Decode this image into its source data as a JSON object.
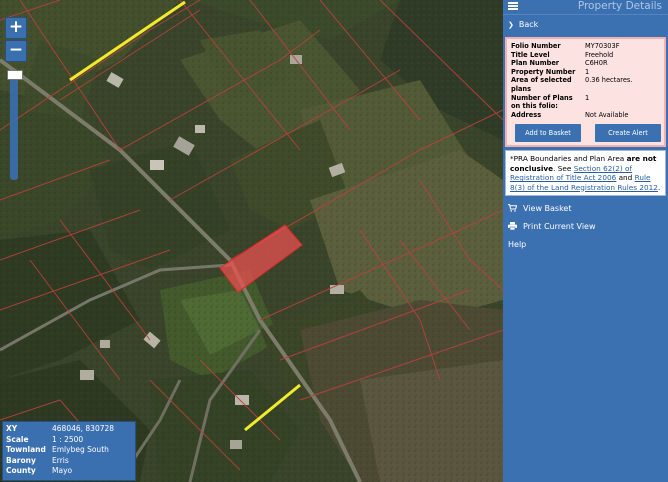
{
  "panel": {
    "title": "Property Details",
    "back_label": "Back",
    "details": [
      {
        "label": "Folio Number",
        "value": "MY70303F"
      },
      {
        "label": "Title Level",
        "value": "Freehold"
      },
      {
        "label": "Plan Number",
        "value": "C6H0R"
      },
      {
        "label": "Property Number",
        "value": "1"
      },
      {
        "label": "Area of selected plans",
        "value": "0.36 hectares."
      },
      {
        "label": "Number of Plans on this folio:",
        "value": "1"
      },
      {
        "label": "Address",
        "value": "Not Available"
      }
    ],
    "add_basket_label": "Add to Basket",
    "create_alert_label": "Create Alert",
    "notice": {
      "prefix": "*PRA Boundaries and Plan Area ",
      "bold": "are not conclusive",
      "mid1": ". See ",
      "link1": "Section 62(2) of Registration of Title Act 2006",
      "mid2": " and ",
      "link2": "Rule 8(3) of the Land Registration Rules 2012",
      "suffix": "."
    },
    "view_basket_label": "View Basket",
    "print_label": "Print Current View",
    "help_label": "Help"
  },
  "map": {
    "zoom_in_label": "+",
    "zoom_out_label": "−",
    "info": [
      {
        "label": "XY",
        "value": "468046, 830728"
      },
      {
        "label": "Scale",
        "value": "1 : 2500"
      },
      {
        "label": "Townland",
        "value": "Emlybeg South"
      },
      {
        "label": "Barony",
        "value": "Erris"
      },
      {
        "label": "County",
        "value": "Mayo"
      }
    ]
  },
  "colors": {
    "panel_blue": "#3b70b1",
    "selected_parcel": "#e85050",
    "boundary_red": "#b8413c",
    "right_of_way_yellow": "#f2ea2a",
    "card_pink": "#fde2e2"
  }
}
